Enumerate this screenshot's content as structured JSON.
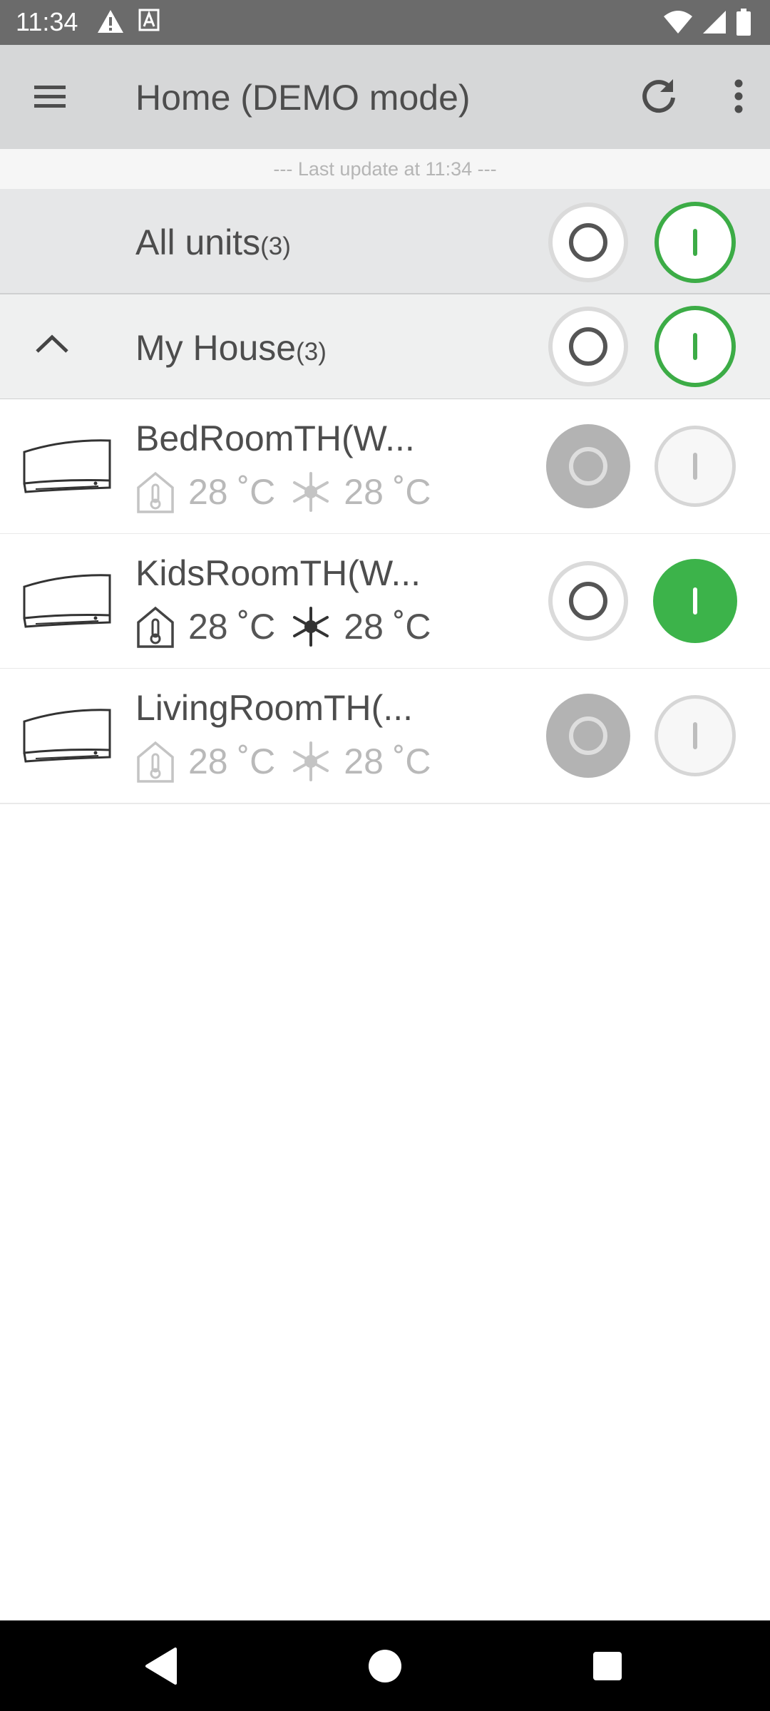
{
  "status_bar": {
    "time": "11:34",
    "left_icons": [
      "warning-icon",
      "a-box-icon"
    ],
    "right_icons": [
      "wifi-icon",
      "signal-icon",
      "battery-icon"
    ]
  },
  "app_bar": {
    "title": "Home (DEMO mode)",
    "icons": [
      "menu-icon",
      "refresh-icon",
      "more-vert-icon"
    ]
  },
  "last_update": "--- Last update at 11:34 ---",
  "groups": [
    {
      "label": "All units",
      "count": "(3)",
      "off_style": "outline",
      "on_style": "green-outline"
    },
    {
      "label": "My House",
      "count": "(3)",
      "off_style": "outline",
      "on_style": "green-outline",
      "expanded": true
    }
  ],
  "units": [
    {
      "name": "BedRoomTH(W...",
      "indoor_temp": "28 ˚C",
      "set_temp": "28 ˚C",
      "mode_icon": "snowflake-icon",
      "state": "disabled"
    },
    {
      "name": "KidsRoomTH(W...",
      "indoor_temp": "28 ˚C",
      "set_temp": "28 ˚C",
      "mode_icon": "snowflake-icon",
      "state": "on"
    },
    {
      "name": "LivingRoomTH(...",
      "indoor_temp": "28 ˚C",
      "set_temp": "28 ˚C",
      "mode_icon": "snowflake-icon",
      "state": "disabled"
    }
  ],
  "colors": {
    "status_bar": "#6b6b6b",
    "app_bar": "#d6d7d8",
    "green": "#3cac46",
    "text": "#4d4d4d",
    "inactive_text": "#b9b9b9"
  },
  "nav_bar": {
    "icons": [
      "back-icon",
      "home-icon",
      "recents-icon"
    ]
  }
}
